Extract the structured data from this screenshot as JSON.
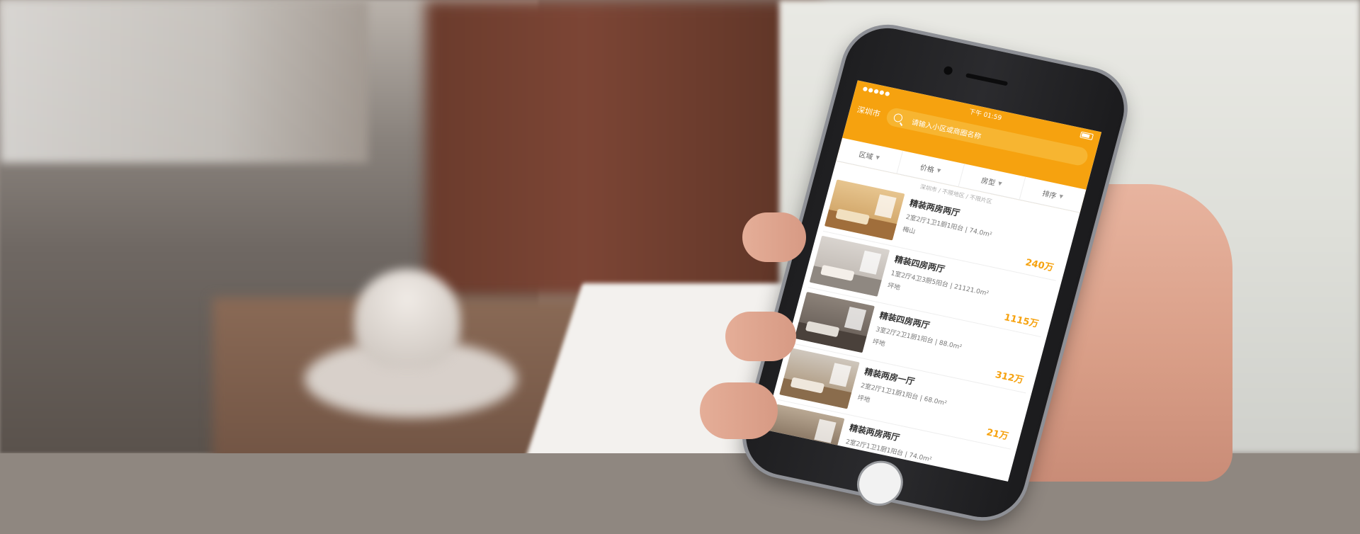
{
  "app": {
    "status": {
      "signal": "●●●●●",
      "time": "下午 01:59"
    },
    "city": "深圳市",
    "search": {
      "placeholder": "请输入小区或商圈名称"
    },
    "filters": [
      "区域",
      "价格",
      "房型",
      "排序"
    ],
    "breadcrumb": "深圳市 / 不限地区 / 不限片区",
    "listings": [
      {
        "title": "精装两房两厅",
        "spec": "2室2厅1卫1厨1阳台 | 74.0m²",
        "location": "梅山",
        "price": "240万"
      },
      {
        "title": "精装四房两厅",
        "spec": "1室2厅4卫3厨5阳台 | 21121.0m²",
        "location": "坪地",
        "price": "1115万"
      },
      {
        "title": "精装四房两厅",
        "spec": "3室2厅2卫1厨1阳台 | 88.0m²",
        "location": "坪地",
        "price": "312万"
      },
      {
        "title": "精装两房一厅",
        "spec": "2室2厅1卫1厨1阳台 | 68.0m²",
        "location": "坪地",
        "price": "21万"
      },
      {
        "title": "精装两房两厅",
        "spec": "2室2厅1卫1厨1阳台 | 74.0m²",
        "location": "",
        "price": ""
      }
    ]
  },
  "colors": {
    "accent": "#f6a20f",
    "price": "#f6a20f"
  }
}
